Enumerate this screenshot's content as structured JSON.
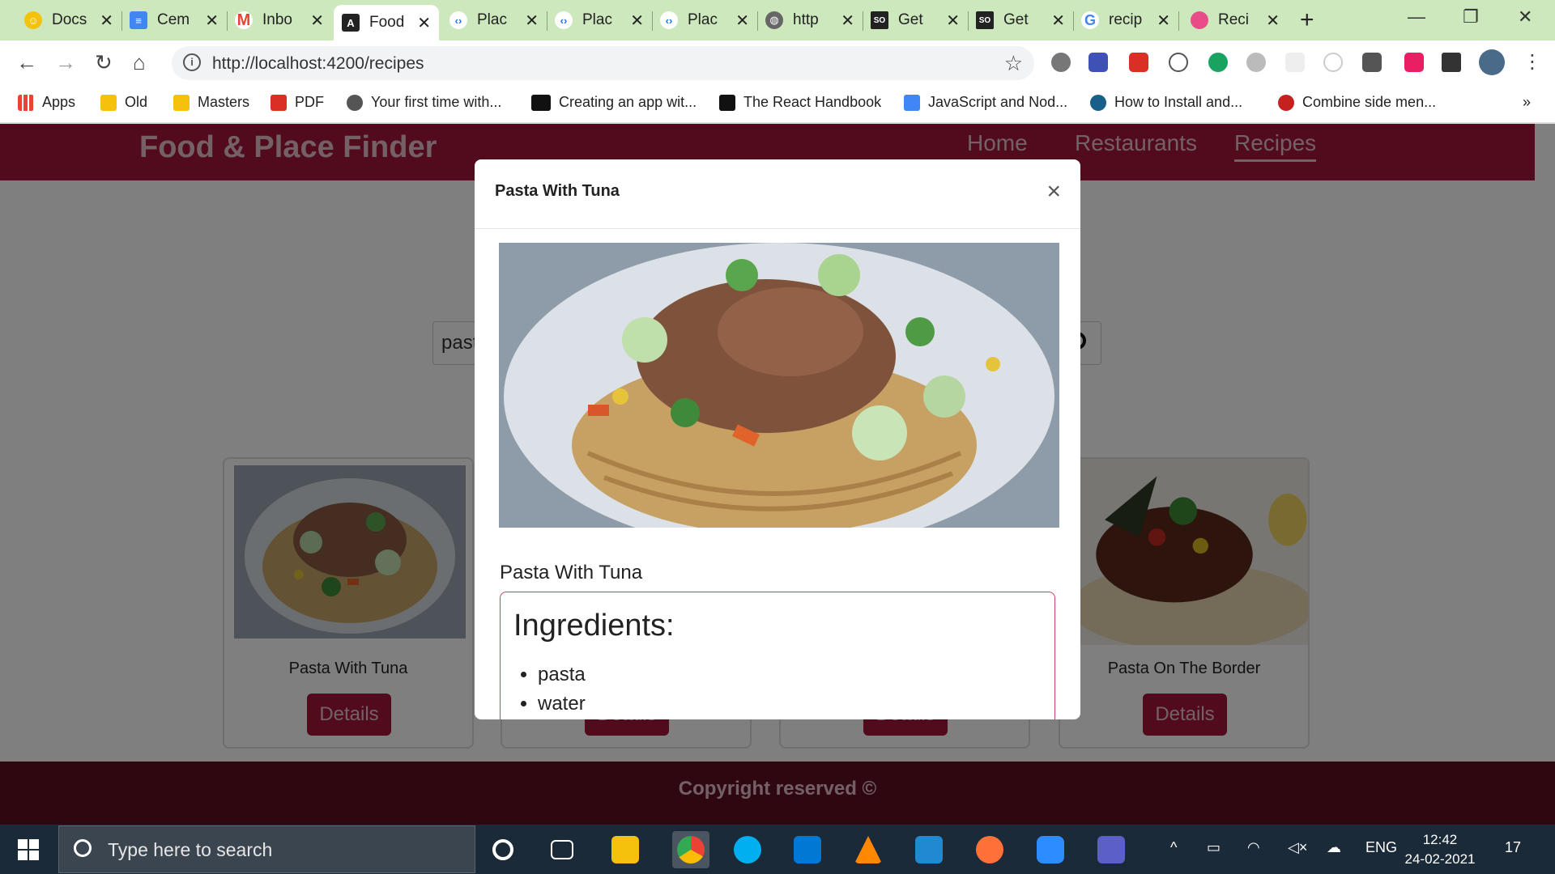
{
  "browser": {
    "tabs": [
      {
        "title": "Docs",
        "icon": "docs-favicon",
        "color": "#f4c20d"
      },
      {
        "title": "Cem",
        "icon": "google-docs-favicon",
        "color": "#4285f4"
      },
      {
        "title": "Inbo",
        "icon": "gmail-favicon",
        "color": "#ea4335"
      },
      {
        "title": "Food",
        "icon": "angular-favicon",
        "color": "#222222"
      },
      {
        "title": "Plac",
        "icon": "code-favicon",
        "color": "#1a73e8"
      },
      {
        "title": "Plac",
        "icon": "code-favicon",
        "color": "#1a73e8"
      },
      {
        "title": "Plac",
        "icon": "code-favicon",
        "color": "#1a73e8"
      },
      {
        "title": "http",
        "icon": "globe-favicon",
        "color": "#666666"
      },
      {
        "title": "Get",
        "icon": "stackoverflow-favicon",
        "color": "#222222"
      },
      {
        "title": "Get",
        "icon": "stackoverflow-favicon",
        "color": "#222222"
      },
      {
        "title": "recip",
        "icon": "google-favicon",
        "color": "#4285f4"
      },
      {
        "title": "Reci",
        "icon": "dribbble-favicon",
        "color": "#ea4c89"
      }
    ],
    "url": "http://localhost:4200/recipes",
    "bookmarks": [
      {
        "label": "Apps",
        "color": "#ea4335"
      },
      {
        "label": "Old",
        "color": "#f4c20d"
      },
      {
        "label": "Masters",
        "color": "#f4c20d"
      },
      {
        "label": "PDF",
        "color": "#d93025"
      },
      {
        "label": "Your first time with...",
        "color": "#555555"
      },
      {
        "label": "Creating an app wit...",
        "color": "#111111"
      },
      {
        "label": "The React Handbook",
        "color": "#111111"
      },
      {
        "label": "JavaScript and Nod...",
        "color": "#4285f4"
      },
      {
        "label": "How to Install and...",
        "color": "#1a5f8a"
      },
      {
        "label": "Combine side men...",
        "color": "#c5221f"
      }
    ],
    "bookmarks_more": "»"
  },
  "app": {
    "brand": "Food & Place Finder",
    "nav": {
      "home": "Home",
      "restaurants": "Restaurants",
      "recipes": "Recipes"
    },
    "search_value": "past",
    "cards": [
      {
        "name": "Pasta With Tuna",
        "button": "Details"
      },
      {
        "name": "",
        "button": "Details"
      },
      {
        "name": "",
        "button": "Details"
      },
      {
        "name": "Pasta On The Border",
        "button": "Details"
      }
    ],
    "footer": "Copyright reserved ©"
  },
  "modal": {
    "title": "Pasta With Tuna",
    "close": "×",
    "dish_name": "Pasta With Tuna",
    "ingredients_title": "Ingredients:",
    "ingredients": [
      "pasta",
      "water"
    ]
  },
  "taskbar": {
    "search_placeholder": "Type here to search",
    "language": "ENG",
    "time": "12:42",
    "date": "24-02-2021",
    "notifications": "17"
  }
}
